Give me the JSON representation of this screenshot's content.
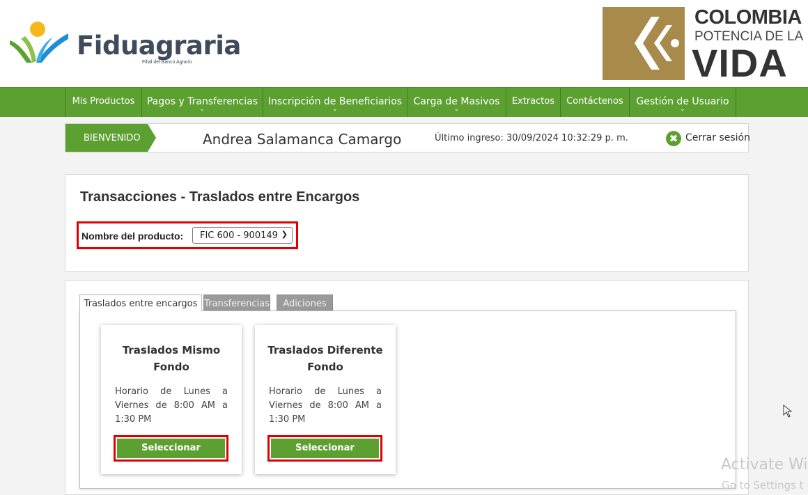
{
  "brand": {
    "name": "Fiduagraria",
    "subtitle": "Filial del Banco Agrario",
    "gov_line1": "COLOMBIA",
    "gov_line2": "POTENCIA DE LA",
    "gov_line3": "VIDA"
  },
  "nav": {
    "items": [
      {
        "label": "Mis Productos",
        "has_dropdown": false
      },
      {
        "label": "Pagos y Transferencias",
        "has_dropdown": true
      },
      {
        "label": "Inscripción de Beneficiarios",
        "has_dropdown": true
      },
      {
        "label": "Carga de Masivos",
        "has_dropdown": true
      },
      {
        "label": "Extractos",
        "has_dropdown": false
      },
      {
        "label": "Contáctenos",
        "has_dropdown": false
      },
      {
        "label": "Gestión de Usuario",
        "has_dropdown": true
      }
    ]
  },
  "welcome": {
    "tag": "BIENVENIDO",
    "user_name": "Andrea Salamanca Camargo",
    "last_login": "Último ingreso: 30/09/2024 10:32:29 p. m.",
    "logout": "Cerrar sesión"
  },
  "main": {
    "title": "Transacciones - Traslados entre Encargos",
    "product_label": "Nombre del producto:",
    "product_value": "FIC 600 - 900149"
  },
  "tabs": [
    {
      "label": "Traslados entre encargos",
      "active": true
    },
    {
      "label": "Transferencias",
      "active": false
    },
    {
      "label": "Adiciones",
      "active": false
    }
  ],
  "options": [
    {
      "title": "Traslados Mismo Fondo",
      "description": "Horario de Lunes a Viernes de 8:00 AM a 1:30 PM",
      "button": "Seleccionar"
    },
    {
      "title": "Traslados Diferente Fondo",
      "description": "Horario de Lunes a Viernes de 8:00 AM a 1:30 PM",
      "button": "Seleccionar"
    }
  ],
  "watermark": {
    "line1": "Activate Wi",
    "line2": "Go to Settings t"
  },
  "colors": {
    "brand_green": "#5da032",
    "highlight_red": "#e00000",
    "gov_gold": "#a88a4a"
  }
}
